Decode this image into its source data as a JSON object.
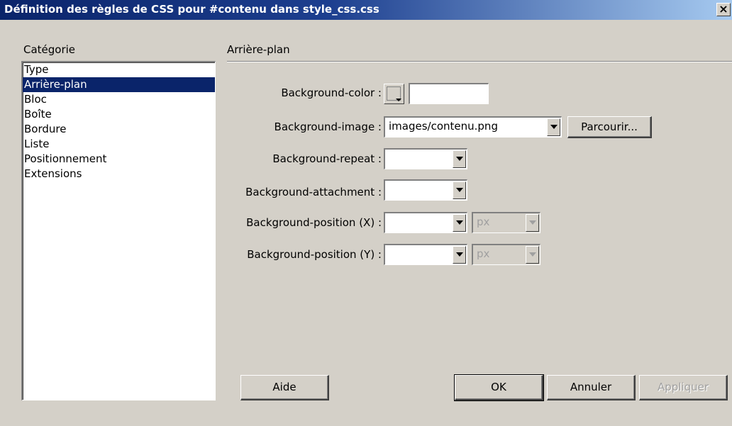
{
  "window": {
    "title": "Définition des règles de CSS pour #contenu dans style_css.css",
    "close_glyph": "×"
  },
  "category": {
    "label": "Catégorie",
    "items": [
      "Type",
      "Arrière-plan",
      "Bloc",
      "Boîte",
      "Bordure",
      "Liste",
      "Positionnement",
      "Extensions"
    ],
    "selected": "Arrière-plan"
  },
  "section": {
    "title": "Arrière-plan"
  },
  "fields": {
    "bg_color": {
      "label": "Background-color :",
      "value": ""
    },
    "bg_image": {
      "label": "Background-image :",
      "value": "images/contenu.png",
      "browse_label": "Parcourir..."
    },
    "bg_repeat": {
      "label": "Background-repeat :",
      "value": ""
    },
    "bg_attachment": {
      "label": "Background-attachment :",
      "value": ""
    },
    "bg_pos_x": {
      "label": "Background-position (X) :",
      "value": "",
      "unit": "px"
    },
    "bg_pos_y": {
      "label": "Background-position (Y) :",
      "value": "",
      "unit": "px"
    }
  },
  "buttons": {
    "help": "Aide",
    "ok": "OK",
    "cancel": "Annuler",
    "apply": "Appliquer"
  },
  "colors": {
    "titlebar_start": "#0a246a",
    "dialog_bg": "#d4d0c8",
    "selection": "#0a246a"
  }
}
